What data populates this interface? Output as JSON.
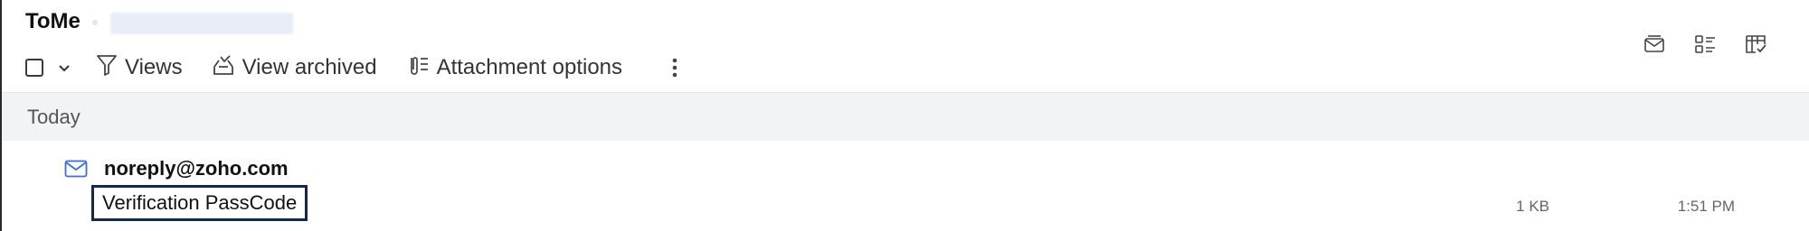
{
  "folder": {
    "title": "ToMe"
  },
  "toolbar": {
    "views_label": "Views",
    "view_archived_label": "View archived",
    "attachment_options_label": "Attachment options"
  },
  "group": {
    "label": "Today"
  },
  "messages": [
    {
      "sender": "noreply@zoho.com",
      "subject": "Verification PassCode",
      "size": "1 KB",
      "time": "1:51 PM"
    }
  ],
  "colors": {
    "selection_border": "#14284a",
    "group_header_bg": "#f2f3f4",
    "mail_icon": "#3c6fd1"
  }
}
